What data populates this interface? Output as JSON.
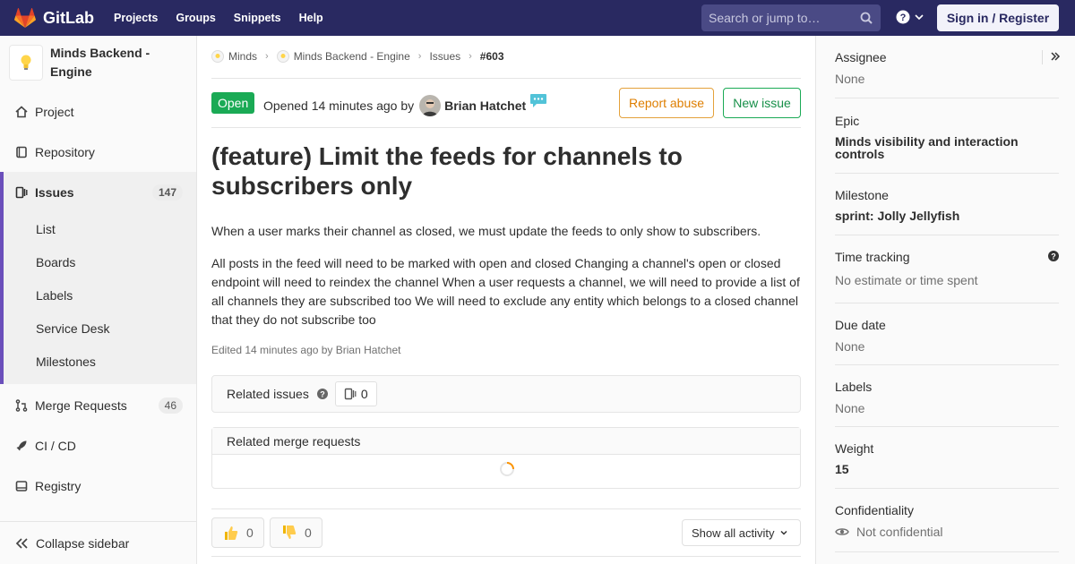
{
  "topbar": {
    "brand": "GitLab",
    "nav": [
      "Projects",
      "Groups",
      "Snippets",
      "Help"
    ],
    "search_placeholder": "Search or jump to…",
    "signin": "Sign in / Register"
  },
  "sidebar": {
    "project_name": "Minds Backend - Engine",
    "items": {
      "project": "Project",
      "repository": "Repository",
      "issues": "Issues",
      "issues_count": "147",
      "merge_requests": "Merge Requests",
      "mr_count": "46",
      "cicd": "CI / CD",
      "registry": "Registry"
    },
    "sub": [
      "List",
      "Boards",
      "Labels",
      "Service Desk",
      "Milestones"
    ],
    "collapse": "Collapse sidebar"
  },
  "breadcrumb": {
    "group": "Minds",
    "project": "Minds Backend - Engine",
    "section": "Issues",
    "current": "#603"
  },
  "issue": {
    "status": "Open",
    "opened_text": "Opened 14 minutes ago by",
    "author": "Brian Hatchet",
    "report_abuse": "Report abuse",
    "new_issue": "New issue",
    "title": "(feature) Limit the feeds for channels to subscribers only",
    "desc1": "When a user marks their channel as closed, we must update the feeds to only show to subscribers.",
    "desc2": "All posts in the feed will need to be marked with open and closed Changing a channel's open or closed endpoint will need to reindex the channel When a user requests a channel, we will need to provide a list of all channels they are subscribed too We will need to exclude any entity which belongs to a closed channel that they do not subscribe too",
    "edited": "Edited 14 minutes ago by Brian Hatchet",
    "related_issues": "Related issues",
    "related_issues_count": "0",
    "related_mrs": "Related merge requests",
    "thumbs_up": "0",
    "thumbs_down": "0",
    "show_activity": "Show all activity"
  },
  "right": {
    "assignee_label": "Assignee",
    "assignee_value": "None",
    "epic_label": "Epic",
    "epic_value": "Minds visibility and interaction controls",
    "milestone_label": "Milestone",
    "milestone_value": "sprint: Jolly Jellyfish",
    "time_label": "Time tracking",
    "time_value": "No estimate or time spent",
    "due_label": "Due date",
    "due_value": "None",
    "labels_label": "Labels",
    "labels_value": "None",
    "weight_label": "Weight",
    "weight_value": "15",
    "conf_label": "Confidentiality",
    "conf_value": "Not confidential"
  },
  "colors": {
    "nav_bg": "#292961",
    "open_green": "#1aaa55",
    "report_orange": "#de7e00",
    "active_purple": "#6b4fbb"
  }
}
